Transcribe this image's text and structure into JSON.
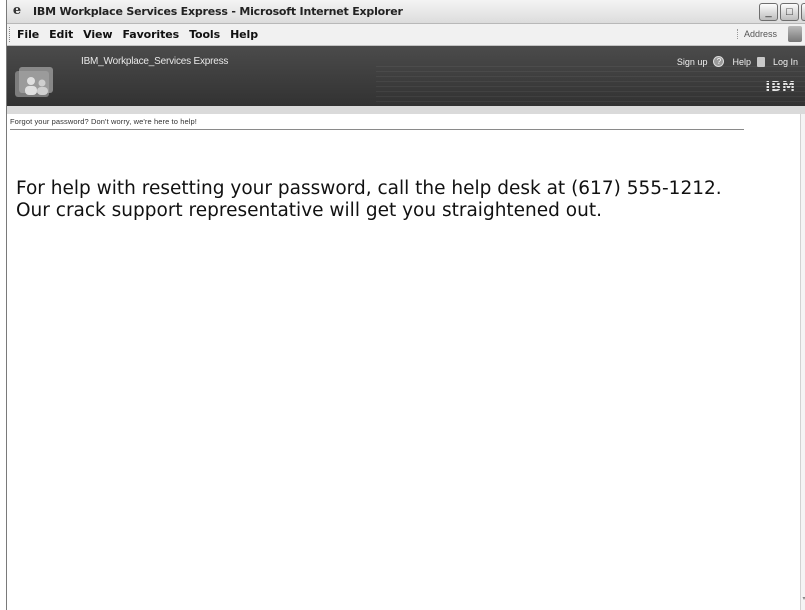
{
  "window": {
    "title": "IBM Workplace Services Express - Microsoft Internet Explorer",
    "controls": {
      "minimize": "_",
      "maximize": "□",
      "close": "X"
    }
  },
  "menubar": {
    "items": [
      "File",
      "Edit",
      "View",
      "Favorites",
      "Tools",
      "Help"
    ],
    "address_label": "Address"
  },
  "banner": {
    "product_name": "IBM_Workplace_Services Express",
    "links": {
      "signup": "Sign up",
      "help": "Help",
      "login": "Log In"
    },
    "brand": "IBM"
  },
  "page": {
    "tagline": "Forgot your password? Don't worry, we're here to help!",
    "message_line1": "For help with resetting your password, call the help desk at (617) 555-1212.",
    "message_line2": "Our crack support representative will get you straightened out."
  }
}
